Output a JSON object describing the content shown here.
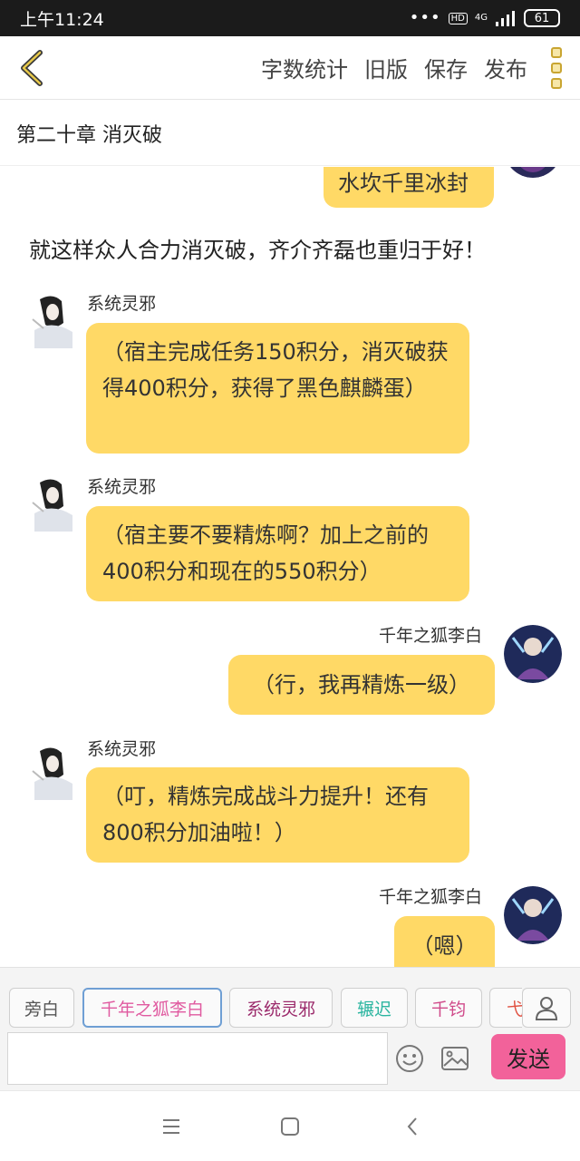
{
  "status_bar": {
    "time": "上午11:24",
    "dots": "•••",
    "hd": "HD",
    "network": "4G",
    "battery": "61"
  },
  "nav": {
    "word_count": "字数统计",
    "old_version": "旧版",
    "save": "保存",
    "publish": "发布"
  },
  "chapter": {
    "title": "第二十章 消灭破"
  },
  "chat": {
    "partial_top_bubble": "水坎千里冰封",
    "narration": "就这样众人合力消灭破，齐介齐磊也重归于好！",
    "messages": [
      {
        "sender": "系统灵邪",
        "text": "（宿主完成任务150积分，消灭破获得400积分，获得了黑色麒麟蛋）"
      },
      {
        "sender": "系统灵邪",
        "text": "（宿主要不要精炼啊？加上之前的400积分和现在的550积分）"
      },
      {
        "sender": "千年之狐李白",
        "text": "（行，我再精炼一级）"
      },
      {
        "sender": "系统灵邪",
        "text": "（叮，精炼完成战斗力提升！还有800积分加油啦！）"
      },
      {
        "sender": "千年之狐李白",
        "text": "（嗯）"
      }
    ]
  },
  "characters": [
    {
      "label": "旁白",
      "color": "#555555"
    },
    {
      "label": "千年之狐李白",
      "color": "#e05aa0"
    },
    {
      "label": "系统灵邪",
      "color": "#9b2a6b"
    },
    {
      "label": "辗迟",
      "color": "#2bb5a0"
    },
    {
      "label": "千钧",
      "color": "#d04a8a"
    },
    {
      "label": "弋",
      "color": "#e05040"
    }
  ],
  "input": {
    "placeholder": "",
    "send_label": "发送"
  },
  "colors": {
    "bubble": "#ffd966",
    "accent_pink": "#f2629a",
    "active_chip_border": "#6f9fd4"
  }
}
